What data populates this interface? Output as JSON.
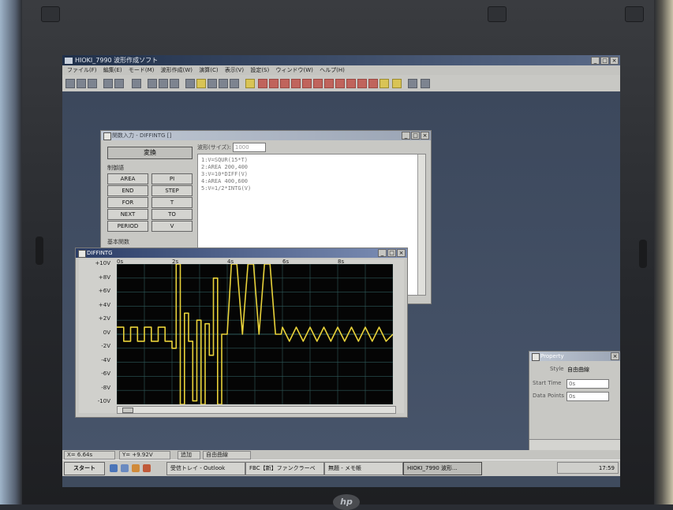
{
  "app": {
    "title": "HIOKI_7990 波形作成ソフト",
    "menu": [
      "ファイル(F)",
      "編集(E)",
      "モード(M)",
      "波形作成(W)",
      "演算(C)",
      "表示(V)",
      "設定(S)",
      "ウィンドウ(W)",
      "ヘルプ(H)"
    ]
  },
  "function_window": {
    "title": "関数入力 - DIFFINTG []",
    "convert_label": "変換",
    "control_label": "制御語",
    "basic_label": "基本関数",
    "keywords": [
      "AREA",
      "PI",
      "END",
      "STEP",
      "FOR",
      "T",
      "NEXT",
      "TO",
      "PERIOD",
      "V"
    ],
    "wave_size_label": "波形(サイズ):",
    "wave_size_value": "1000",
    "code_lines": [
      "1:V=SQUR(15*T)",
      "2:AREA 200,400",
      "3:V=10*DIFF(V)",
      "4:AREA 400,600",
      "5:V=1/2*INTG(V)"
    ]
  },
  "plot_window": {
    "title": "DIFFINTG",
    "y_tick_labels": [
      "+10V",
      "+8V",
      "+6V",
      "+4V",
      "+2V",
      "0V",
      "-2V",
      "-4V",
      "-6V",
      "-8V",
      "-10V"
    ],
    "x_tick_labels": [
      "0s",
      "2s",
      "4s",
      "6s",
      "8s"
    ]
  },
  "chart_data": {
    "type": "line",
    "title": "DIFFINTG",
    "xlabel": "",
    "ylabel": "",
    "x_tick_labels": [
      "0s",
      "2s",
      "4s",
      "6s",
      "8s"
    ],
    "y_tick_labels": [
      "+10V",
      "+8V",
      "+6V",
      "+4V",
      "+2V",
      "0V",
      "-2V",
      "-4V",
      "-6V",
      "-8V",
      "-10V"
    ],
    "xlim": [
      0,
      10
    ],
    "ylim": [
      -10,
      10
    ],
    "grid": true,
    "series": [
      {
        "color": "#e8d23a",
        "x": [
          0,
          0.25,
          0.25,
          0.5,
          0.5,
          0.75,
          0.75,
          1.0,
          1.0,
          1.25,
          1.25,
          1.5,
          1.5,
          1.75,
          1.75,
          2.0,
          2.0,
          2.15,
          2.15,
          2.3,
          2.3,
          2.45,
          2.45,
          2.6,
          2.6,
          2.75,
          2.75,
          2.9,
          2.9,
          3.05,
          3.05,
          3.2,
          3.2,
          3.35,
          3.35,
          3.5,
          3.5,
          3.65,
          3.65,
          3.8,
          3.8,
          4.0,
          4.15,
          4.35,
          4.55,
          4.75,
          4.95,
          5.15,
          5.35,
          5.55,
          5.75,
          5.95,
          6.0,
          6.0,
          6.25,
          6.25,
          6.5,
          6.5,
          6.75,
          6.75,
          7.0,
          7.0,
          7.25,
          7.25,
          7.5,
          7.5,
          7.75,
          7.75,
          8.0,
          8.0,
          8.25,
          8.25,
          8.5,
          8.5,
          8.75,
          8.75,
          9.0,
          9.0,
          9.25,
          9.25,
          9.5,
          9.5,
          9.75,
          9.75,
          10.0
        ],
        "y": [
          1,
          1,
          -1,
          -1,
          1,
          1,
          -1,
          -1,
          1,
          1,
          -1,
          -1,
          1,
          1,
          -1,
          -1,
          -2,
          -2,
          10,
          10,
          -10,
          -10,
          3,
          3,
          -1,
          -1,
          -9.5,
          -9.5,
          2,
          2,
          -10,
          -10,
          1.5,
          1.5,
          -3,
          -3,
          8,
          8,
          -10,
          -10,
          0,
          0,
          10,
          10,
          0,
          10,
          10,
          0,
          10,
          10,
          0,
          0,
          1,
          1,
          -1,
          -1,
          1,
          1,
          -1,
          -1,
          1,
          1,
          -1,
          -1,
          1,
          1,
          -1,
          -1,
          1,
          1,
          -1,
          -1,
          1,
          1,
          -1,
          -1,
          1,
          1,
          -1,
          -1,
          1,
          1,
          -1,
          -1,
          0
        ]
      }
    ]
  },
  "property_window": {
    "title": "Property",
    "style_label": "Style",
    "style_value": "自由曲線",
    "start_time_label": "Start Time",
    "start_time_value": "0s",
    "data_points_label": "Data Points",
    "data_points_value": "0s"
  },
  "statusbar": {
    "time": "X= 6.64s",
    "voltage": "Y= +9.92V",
    "mode": "追加",
    "style": "自由曲線"
  },
  "taskbar": {
    "start_label": "スタート",
    "tasks": [
      "受信トレイ - Outlook",
      "FBC【新】ファンクラーベ",
      "無題 - メモ帳",
      "HIOKI_7990 波形..."
    ],
    "clock": "17:59"
  },
  "colors": {
    "trace": "#e8d23a",
    "plot_bg": "#050505",
    "grid": "#2f5a5a",
    "title_active": "#2b3d66"
  }
}
